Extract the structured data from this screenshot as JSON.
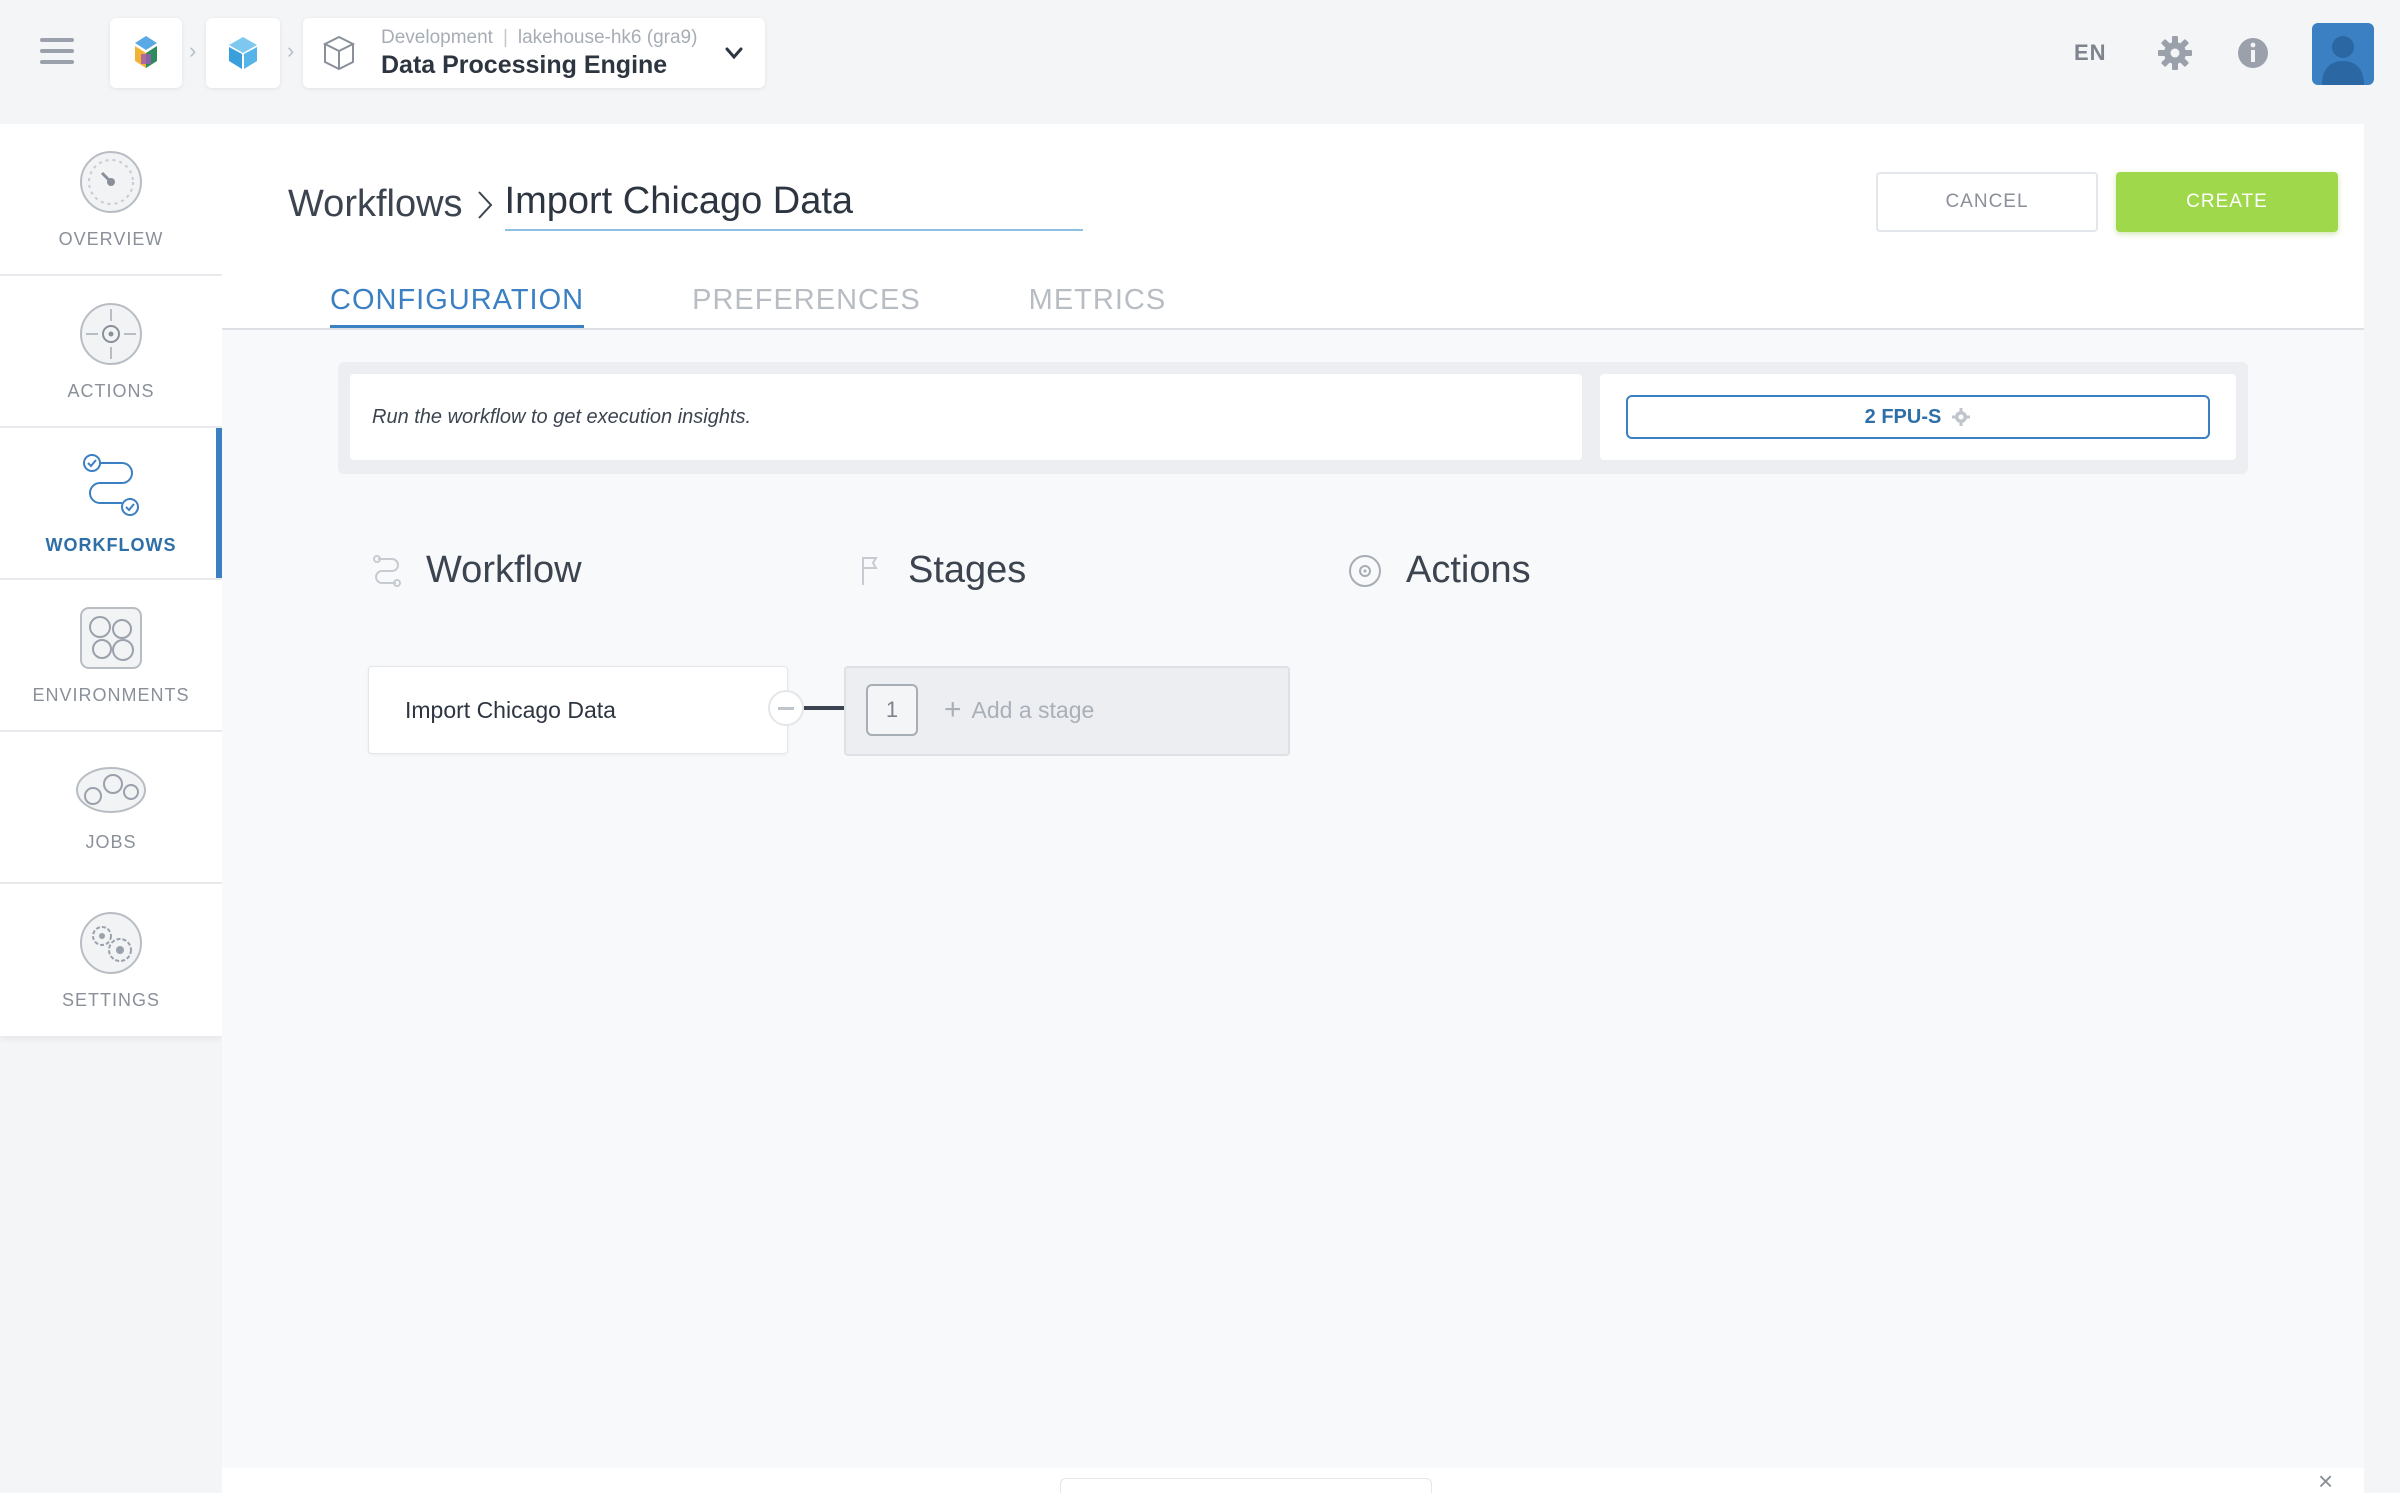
{
  "header": {
    "project": {
      "env": "Development",
      "cluster": "lakehouse-hk6 (gra9)",
      "name": "Data Processing Engine"
    },
    "language": "EN",
    "breadcrumb_separator": "›"
  },
  "sidebar": {
    "items": [
      {
        "label": "OVERVIEW",
        "icon": "gauge-icon",
        "active": false
      },
      {
        "label": "ACTIONS",
        "icon": "target-icon",
        "active": false
      },
      {
        "label": "WORKFLOWS",
        "icon": "workflow-icon",
        "active": true
      },
      {
        "label": "ENVIRONMENTS",
        "icon": "environment-icon",
        "active": false
      },
      {
        "label": "JOBS",
        "icon": "jobs-icon",
        "active": false
      },
      {
        "label": "SETTINGS",
        "icon": "settings-icon",
        "active": false
      }
    ]
  },
  "main": {
    "breadcrumb_root": "Workflows",
    "workflow_name_value": "Import Chicago Data",
    "cancel_label": "CANCEL",
    "create_label": "CREATE",
    "tabs": [
      {
        "label": "CONFIGURATION",
        "active": true
      },
      {
        "label": "PREFERENCES",
        "active": false
      },
      {
        "label": "METRICS",
        "active": false
      }
    ],
    "info_message": "Run the workflow to get execution insights.",
    "fpu_label": "2 FPU-S",
    "columns": {
      "workflow": "Workflow",
      "stages": "Stages",
      "actions": "Actions"
    },
    "workflow_card_label": "Import Chicago Data",
    "stage_number": "1",
    "add_stage_label": "Add a stage"
  },
  "footer": {
    "close_symbol": "×"
  },
  "colors": {
    "accent": "#3a80c3",
    "create_button": "#9fd84a",
    "background": "#f4f5f7"
  }
}
